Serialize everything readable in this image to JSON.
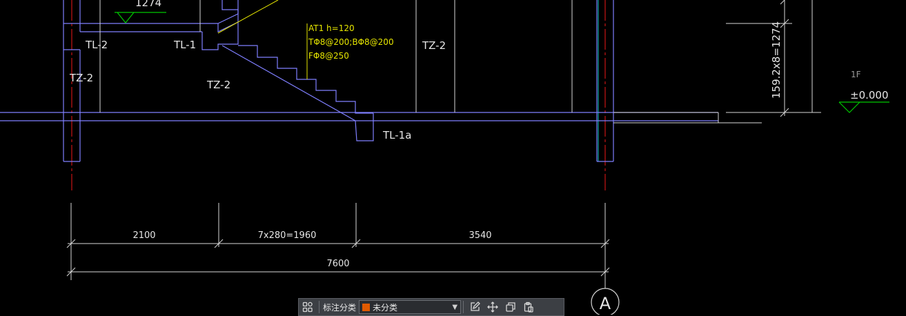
{
  "drawing": {
    "labels": {
      "top_level": "1274",
      "tl2": "TL-2",
      "tl1": "TL-1",
      "tz2_left": "TZ-2",
      "tz2_mid": "TZ-2",
      "tz2_right": "TZ-2",
      "tl1a": "TL-1a",
      "at1_line1": "AT1  h=120",
      "at1_line2": "TΦ8@200;BΦ8@200",
      "at1_line3": "FΦ8@250",
      "floor": "1F",
      "elevation": "±0.000",
      "vertical_dim": "159.2x8=1274"
    },
    "dimensions": {
      "seg1": "2100",
      "seg2": "7x280=1960",
      "seg3": "3540",
      "total": "7600"
    },
    "axis_label": "A",
    "colors": {
      "background": "#000000",
      "structure": "#7f7fff",
      "text": "#e6e6e6",
      "rebar_text": "#e6e600",
      "axis_line": "#c81414",
      "elevation_marker": "#00c800",
      "aux_line": "#00c8c8"
    }
  },
  "toolbar": {
    "icon_left": "grid-apps-icon",
    "label": "标注分类",
    "selected": "未分类",
    "swatch_color": "#e05a00",
    "icons": [
      "edit-icon",
      "move-icon",
      "copy-icon",
      "paste-icon"
    ]
  }
}
